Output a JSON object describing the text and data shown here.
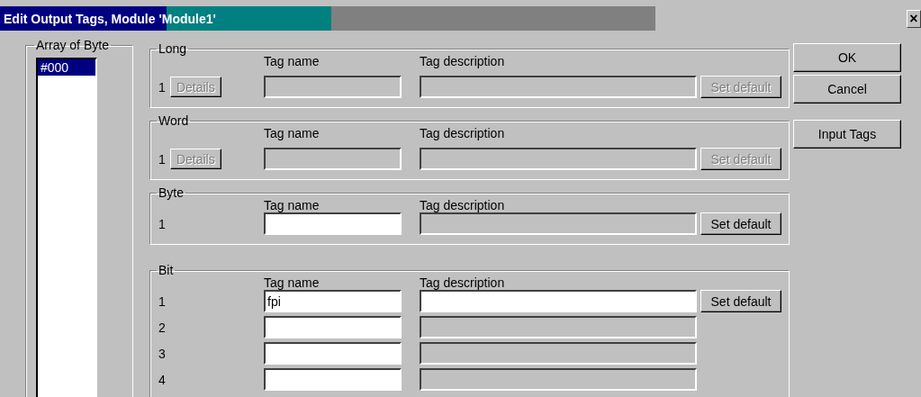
{
  "window": {
    "title": "Edit Output Tags, Module 'Module1'",
    "close": "×"
  },
  "array_group": {
    "title": "Array of Byte",
    "items": [
      {
        "label": "#000",
        "selected": true
      }
    ]
  },
  "groups": [
    {
      "kind": "details",
      "title": "Long",
      "headers": [
        "Tag name",
        "Tag description"
      ],
      "rows": [
        {
          "number": "1",
          "details": {
            "label": "Details",
            "disabled": true
          },
          "tag_name": {
            "disabled": true
          },
          "tag_description": {
            "disabled": true
          },
          "set_default": {
            "label": "Set default",
            "disabled": true
          }
        }
      ]
    },
    {
      "kind": "details",
      "title": "Word",
      "headers": [
        "Tag name",
        "Tag description"
      ],
      "rows": [
        {
          "number": "1",
          "details": {
            "label": "Details",
            "disabled": true
          },
          "tag_name": {
            "disabled": true
          },
          "tag_description": {
            "disabled": true
          },
          "set_default": {
            "label": "Set default",
            "disabled": true
          }
        }
      ]
    },
    {
      "kind": "plain",
      "title": "Byte",
      "headers": [
        "Tag name",
        "Tag description"
      ],
      "rows": [
        {
          "number": "1",
          "tag_name": {
            "disabled": false
          },
          "tag_description": {
            "disabled": true
          },
          "set_default": {
            "label": "Set default",
            "disabled": false
          }
        }
      ]
    },
    {
      "kind": "plain",
      "title": "Bit",
      "headers": [
        "Tag name",
        "Tag description"
      ],
      "rows": [
        {
          "number": "1",
          "tag_name": {
            "value": "fpi",
            "disabled": false
          },
          "tag_description": {
            "disabled": false
          },
          "set_default": {
            "label": "Set default",
            "disabled": false
          }
        },
        {
          "number": "2",
          "tag_name": {
            "disabled": false
          },
          "tag_description": {
            "disabled": true
          }
        },
        {
          "number": "3",
          "tag_name": {
            "disabled": false
          },
          "tag_description": {
            "disabled": true
          }
        },
        {
          "number": "4",
          "tag_name": {
            "disabled": false
          },
          "tag_description": {
            "disabled": true
          }
        }
      ]
    }
  ],
  "buttons": [
    {
      "label": "OK"
    },
    {
      "label": "Cancel"
    }
  ],
  "extra_buttons": [
    {
      "label": "Input Tags"
    }
  ]
}
